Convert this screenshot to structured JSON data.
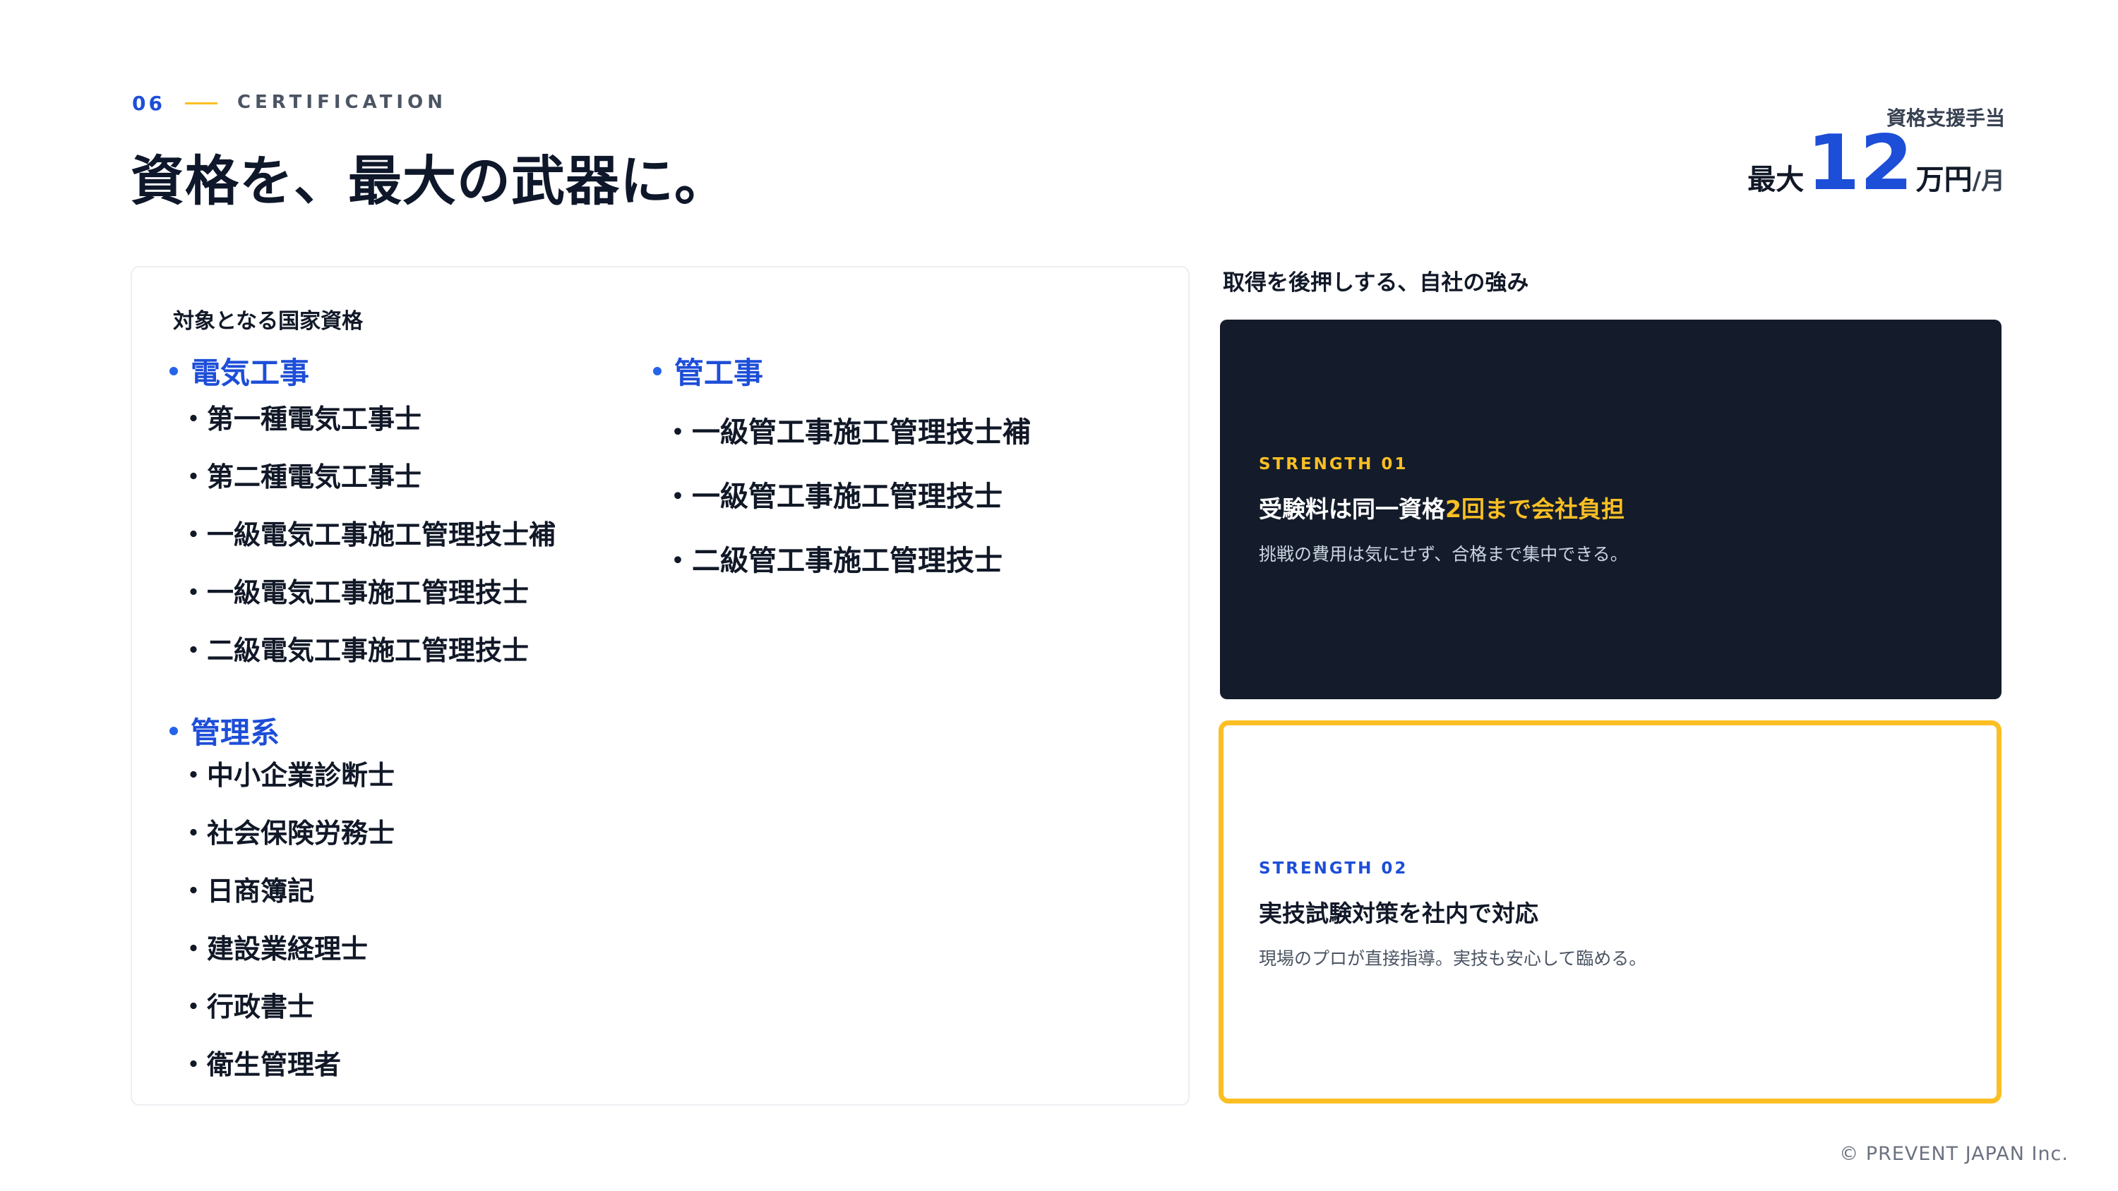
{
  "header": {
    "section_number": "06",
    "section_label": "CERTIFICATION",
    "title": "資格を、最大の武器に。",
    "allowance_label": "資格支援手当",
    "allowance_prefix": "最大",
    "allowance_amount": "12",
    "allowance_unit": "万円",
    "allowance_per": "/月"
  },
  "qualifications": {
    "heading": "対象となる国家資格",
    "categories": [
      {
        "title": "電気工事",
        "items": [
          "・第一種電気工事士",
          "・第二種電気工事士",
          "・一級電気工事施工管理技士補",
          "・一級電気工事施工管理技士",
          "・二級電気工事施工管理技士"
        ]
      },
      {
        "title": "管工事",
        "items": [
          "・一級管工事施工管理技士補",
          "・一級管工事施工管理技士",
          "・二級管工事施工管理技士"
        ]
      },
      {
        "title": "管理系",
        "items": [
          "・中小企業診断士",
          "・社会保険労務士",
          "・日商簿記",
          "・建設業経理士",
          "・行政書士",
          "・衛生管理者"
        ]
      }
    ]
  },
  "strengths": {
    "heading": "取得を後押しする、自社の強み",
    "items": [
      {
        "tag": "STRENGTH 01",
        "title_plain": "受験料は同一資格",
        "title_highlight": "2回まで会社負担",
        "description": "挑戦の費用は気にせず、合格まで集中できる。"
      },
      {
        "tag": "STRENGTH 02",
        "title_plain": "実技試験対策を社内で対応",
        "title_highlight": "",
        "description": "現場のプロが直接指導。実技も安心して臨める。"
      }
    ]
  },
  "footer": {
    "copyright": "© PREVENT JAPAN Inc."
  },
  "colors": {
    "accent_blue": "#1d4ed8",
    "accent_yellow": "#fbbf24",
    "dark_navy": "#141c2b"
  }
}
